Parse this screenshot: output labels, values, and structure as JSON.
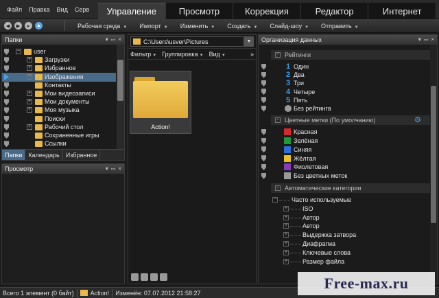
{
  "menu": {
    "items": [
      "Файл",
      "Правка",
      "Вид",
      "Серв"
    ]
  },
  "modes": [
    "Управление",
    "Просмотр",
    "Коррекция",
    "Редактор",
    "Интернет"
  ],
  "toolbar": {
    "items": [
      "Рабочая среда",
      "Импорт",
      "Изменить",
      "Создать",
      "Слайд-шоу",
      "Отправить"
    ]
  },
  "folders_panel": {
    "title": "Папки",
    "tree": [
      {
        "label": "user",
        "level": 0,
        "expander": "−",
        "selected": false,
        "current": false
      },
      {
        "label": "Загрузки",
        "level": 1,
        "expander": "+",
        "selected": false,
        "current": false
      },
      {
        "label": "Избранное",
        "level": 1,
        "expander": "+",
        "selected": false,
        "current": false
      },
      {
        "label": "Изображения",
        "level": 1,
        "expander": "−",
        "selected": true,
        "current": true
      },
      {
        "label": "Контакты",
        "level": 1,
        "expander": "",
        "selected": false,
        "current": false
      },
      {
        "label": "Мои видеозаписи",
        "level": 1,
        "expander": "+",
        "selected": false,
        "current": false
      },
      {
        "label": "Мои документы",
        "level": 1,
        "expander": "+",
        "selected": false,
        "current": false
      },
      {
        "label": "Моя музыка",
        "level": 1,
        "expander": "+",
        "selected": false,
        "current": false
      },
      {
        "label": "Поиски",
        "level": 1,
        "expander": "",
        "selected": false,
        "current": false
      },
      {
        "label": "Рабочий стол",
        "level": 1,
        "expander": "+",
        "selected": false,
        "current": false
      },
      {
        "label": "Сохраненные игры",
        "level": 1,
        "expander": "",
        "selected": false,
        "current": false
      },
      {
        "label": "Ссылки",
        "level": 1,
        "expander": "",
        "selected": false,
        "current": false
      }
    ],
    "tabs": [
      "Папки",
      "Календарь",
      "Избранное"
    ]
  },
  "preview_panel": {
    "title": "Просмотр"
  },
  "browser": {
    "path": "C:\\Users\\usver\\Pictures",
    "filter_items": [
      "Фильтр",
      "Группировка",
      "Вид"
    ],
    "thumbnail_caption": "Action!"
  },
  "organize": {
    "title": "Организация данных",
    "ratings_header": "Рейтинги",
    "ratings": [
      {
        "mark": "1",
        "label": "Один"
      },
      {
        "mark": "2",
        "label": "Два"
      },
      {
        "mark": "3",
        "label": "Три"
      },
      {
        "mark": "4",
        "label": "Четыре"
      },
      {
        "mark": "5",
        "label": "Пять"
      },
      {
        "mark": "",
        "label": "Без рейтинга"
      }
    ],
    "colors_header": "Цветные метки (По умолчанию)",
    "colors": [
      {
        "color": "#d8282f",
        "label": "Красная"
      },
      {
        "color": "#1e9a3a",
        "label": "Зелёная"
      },
      {
        "color": "#2a6fd6",
        "label": "Синяя"
      },
      {
        "color": "#e8c020",
        "label": "Жёлтая"
      },
      {
        "color": "#8a3ab8",
        "label": "Фиолетовая"
      },
      {
        "color": "#9a9a9a",
        "label": "Без цветных меток"
      }
    ],
    "auto_header": "Автоматические категории",
    "auto_categories": [
      {
        "label": "Часто используемые",
        "expander": "−",
        "indent": 0
      },
      {
        "label": "ISO",
        "expander": "+",
        "indent": 1
      },
      {
        "label": "Автор",
        "expander": "+",
        "indent": 1
      },
      {
        "label": "Автор",
        "expander": "+",
        "indent": 1
      },
      {
        "label": "Выдержка затвора",
        "expander": "+",
        "indent": 1
      },
      {
        "label": "Диафрагма",
        "expander": "+",
        "indent": 1
      },
      {
        "label": "Ключевые слова",
        "expander": "+",
        "indent": 1
      },
      {
        "label": "Размер файла",
        "expander": "+",
        "indent": 1
      }
    ]
  },
  "status": {
    "count": "Всего 1 элемент",
    "size": "(0 байт)",
    "current": "Action!",
    "modified": "Изменён: 07.07.2012 21:58:27"
  },
  "watermark": {
    "text": "Free-max.ru"
  }
}
